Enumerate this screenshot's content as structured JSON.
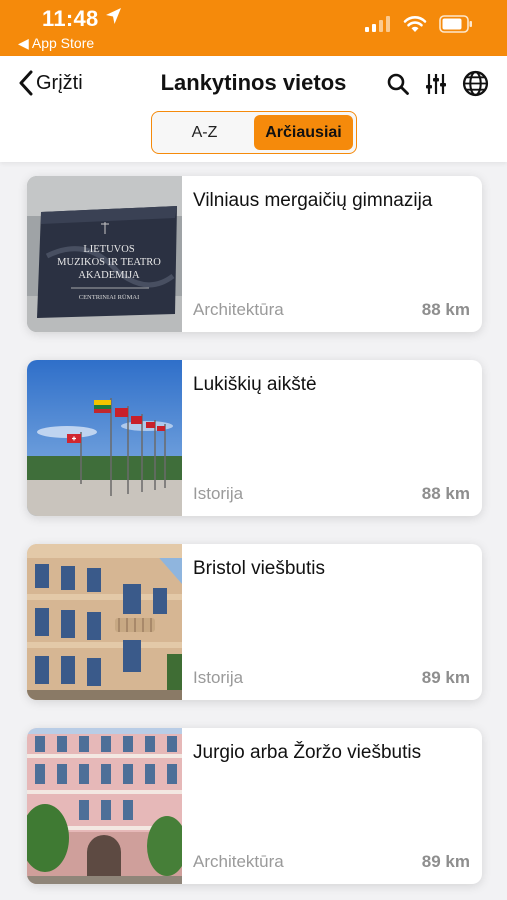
{
  "status_bar": {
    "time": "11:48",
    "back_app": "◀ App Store"
  },
  "nav": {
    "back_label": "Grįžti",
    "title": "Lankytinos vietos"
  },
  "segmented": {
    "options": [
      "A-Z",
      "Arčiausiai"
    ],
    "selected": "Arčiausiai"
  },
  "places": [
    {
      "title": "Vilniaus mergaičių gimnazija",
      "category": "Architektūra",
      "distance": "88 km"
    },
    {
      "title": "Lukiškių aikštė",
      "category": "Istorija",
      "distance": "88 km"
    },
    {
      "title": "Bristol viešbutis",
      "category": "Istorija",
      "distance": "89 km"
    },
    {
      "title": "Jurgio arba Žoržo viešbutis",
      "category": "Architektūra",
      "distance": "89 km"
    }
  ],
  "thumb1_sign": {
    "line1": "LIETUVOS",
    "line2": "MUZIKOS IR TEATRO",
    "line3": "AKADEMIJA",
    "line4": "CENTRINIAI RŪMAI"
  },
  "colors": {
    "accent": "#f58a0b",
    "card_bg": "#ffffff",
    "page_bg": "#f2f2f4"
  }
}
